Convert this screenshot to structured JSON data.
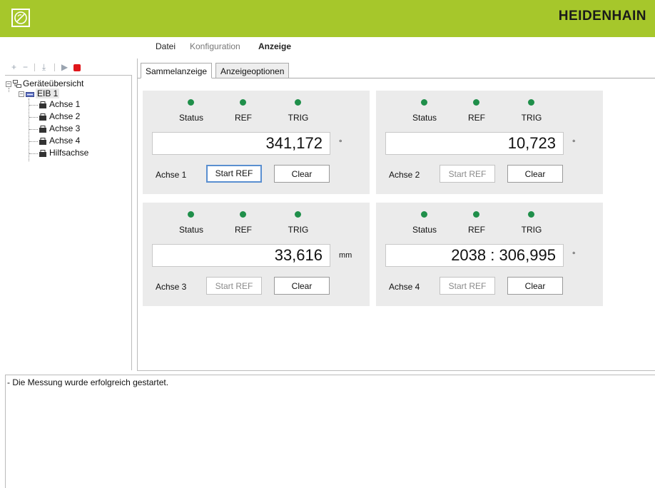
{
  "brand": "HEIDENHAIN",
  "colors": {
    "accent": "#a6c72b",
    "led": "#1f8f4a",
    "stop": "#e0161b"
  },
  "menu": {
    "file": "Datei",
    "config": "Konfiguration",
    "view": "Anzeige"
  },
  "toolbar": {
    "icons": [
      "add-icon",
      "remove-icon",
      "import-icon",
      "play-icon",
      "stop-icon"
    ]
  },
  "tree": {
    "root": "Geräteübersicht",
    "device": "EIB 1",
    "items": [
      "Achse 1",
      "Achse 2",
      "Achse 3",
      "Achse 4",
      "Hilfsachse"
    ]
  },
  "tabs": {
    "collective": "Sammelanzeige",
    "options": "Anzeigeoptionen"
  },
  "labels": {
    "status": "Status",
    "ref": "REF",
    "trig": "TRIG",
    "start_ref": "Start REF",
    "clear": "Clear"
  },
  "axes": [
    {
      "name": "Achse 1",
      "value": "341,172",
      "unit": "°",
      "start_ref_enabled": true
    },
    {
      "name": "Achse 2",
      "value": "10,723",
      "unit": "°",
      "start_ref_enabled": false
    },
    {
      "name": "Achse 3",
      "value": "33,616",
      "unit": "mm",
      "start_ref_enabled": false
    },
    {
      "name": "Achse 4",
      "value": "2038 : 306,995",
      "unit": "°",
      "start_ref_enabled": false
    }
  ],
  "log": {
    "message": "- Die Messung wurde erfolgreich gestartet."
  }
}
